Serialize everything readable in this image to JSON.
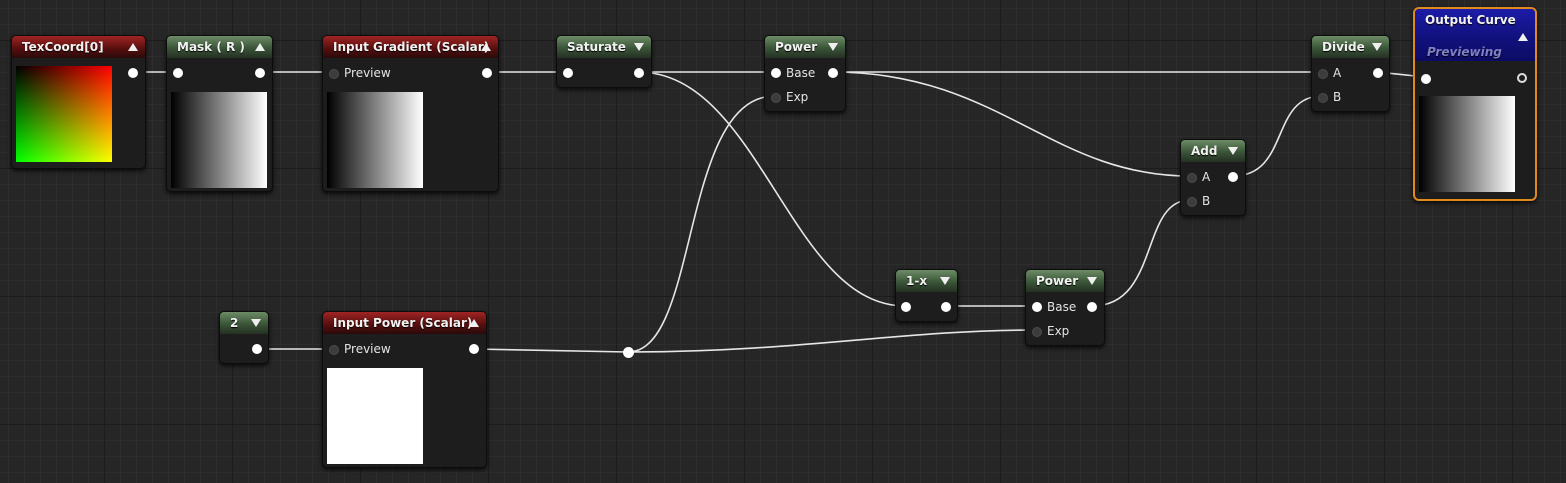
{
  "nodes": {
    "texcoord": {
      "title": "TexCoord[0]"
    },
    "mask": {
      "title": "Mask ( R )"
    },
    "input_gradient": {
      "title": "Input Gradient (Scalar)",
      "pin_label": "Preview"
    },
    "saturate": {
      "title": "Saturate"
    },
    "power_top": {
      "title": "Power",
      "pin_base": "Base",
      "pin_exp": "Exp"
    },
    "divide": {
      "title": "Divide",
      "pin_a": "A",
      "pin_b": "B"
    },
    "output_curve": {
      "title": "Output Curve",
      "subtitle": "Previewing"
    },
    "add": {
      "title": "Add",
      "pin_a": "A",
      "pin_b": "B"
    },
    "constant": {
      "title": "2"
    },
    "input_power": {
      "title": "Input Power (Scalar)",
      "pin_label": "Preview"
    },
    "one_minus": {
      "title": "1-x"
    },
    "power_bottom": {
      "title": "Power",
      "pin_base": "Base",
      "pin_exp": "Exp"
    }
  },
  "colors": {
    "background": "#262626",
    "node_body": "#1d1d1d",
    "param_header": "#8e1f1f",
    "function_header": "#4a6a44",
    "output_header": "#14148c",
    "selection_outline": "#e08a1e",
    "wire": "#e8e8e8"
  }
}
